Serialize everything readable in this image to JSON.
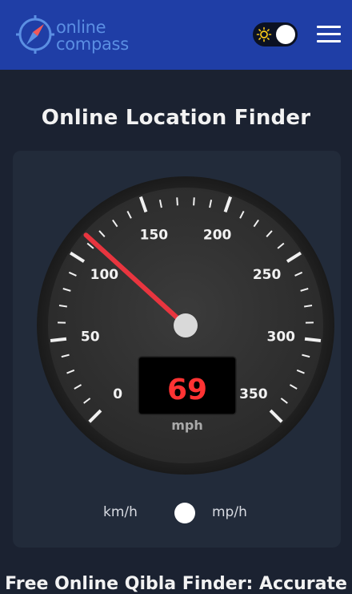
{
  "header": {
    "logo_line1": "online",
    "logo_line2": "compass",
    "theme_toggle_state": "light",
    "logo_icon": "compass-icon",
    "theme_icon": "sun-icon",
    "menu_icon": "hamburger-menu-icon"
  },
  "page": {
    "title": "Online Location Finder",
    "sub_heading": "Free Online Qibla Finder: Accurate"
  },
  "speedometer": {
    "min": 0,
    "max": 350,
    "value": 69,
    "display_value": "69",
    "needle_value": 113,
    "unit": "mph",
    "tick_labels": [
      "0",
      "50",
      "100",
      "150",
      "200",
      "250",
      "300",
      "350"
    ]
  },
  "units": {
    "left_label": "km/h",
    "right_label": "mp/h",
    "selected": "mp/h"
  },
  "colors": {
    "header_bg": "#1f3ea6",
    "accent_red": "#ff3333",
    "needle": "#e8353f"
  }
}
